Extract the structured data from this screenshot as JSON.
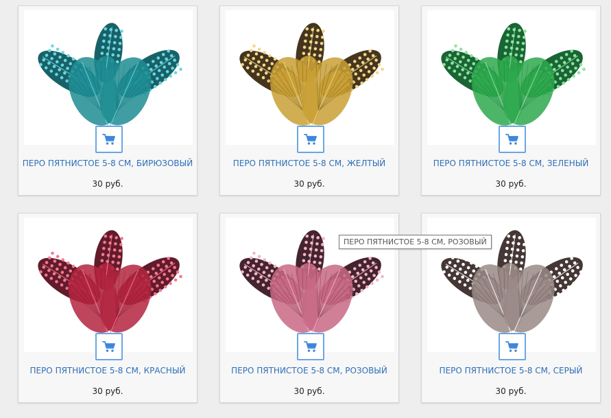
{
  "products": [
    {
      "title": "ПЕРО ПЯТНИСТОЕ 5-8 СМ, БИРЮЗОВЫЙ",
      "price": "30 руб.",
      "feather_color": "#1f8d93",
      "feather_dark": "#0b5a61",
      "spot_color": "#6fd5de",
      "image": "turquoise-feathers"
    },
    {
      "title": "ПЕРО ПЯТНИСТОЕ 5-8 СМ, ЖЕЛТЫЙ",
      "price": "30 руб.",
      "feather_color": "#c9a035",
      "feather_dark": "#3c2a12",
      "spot_color": "#f2d88a",
      "image": "yellow-feathers"
    },
    {
      "title": "ПЕРО ПЯТНИСТОЕ 5-8 СМ, ЗЕЛЕНЫЙ",
      "price": "30 руб.",
      "feather_color": "#2ea84e",
      "feather_dark": "#0d5d28",
      "spot_color": "#8fe2a3",
      "image": "green-feathers"
    },
    {
      "title": "ПЕРО ПЯТНИСТОЕ 5-8 СМ, КРАСНЫЙ",
      "price": "30 руб.",
      "feather_color": "#b3243f",
      "feather_dark": "#5a0f1f",
      "spot_color": "#f07a92",
      "image": "red-feathers"
    },
    {
      "title": "ПЕРО ПЯТНИСТОЕ 5-8 СМ, РОЗОВЫЙ",
      "price": "30 руб.",
      "feather_color": "#c86985",
      "feather_dark": "#3a1823",
      "spot_color": "#f3b6c8",
      "image": "pink-feathers"
    },
    {
      "title": "ПЕРО ПЯТНИСТОЕ 5-8 СМ, СЕРЫЙ",
      "price": "30 руб.",
      "feather_color": "#9a8a86",
      "feather_dark": "#3b2c2a",
      "spot_color": "#ffffff",
      "image": "grey-feathers"
    }
  ],
  "tooltip": {
    "text": "ПЕРО ПЯТНИСТОЕ 5-8 СМ, РОЗОВЫЙ"
  },
  "cart_icon": {
    "name": "cart-icon",
    "color": "#3d86dc"
  }
}
